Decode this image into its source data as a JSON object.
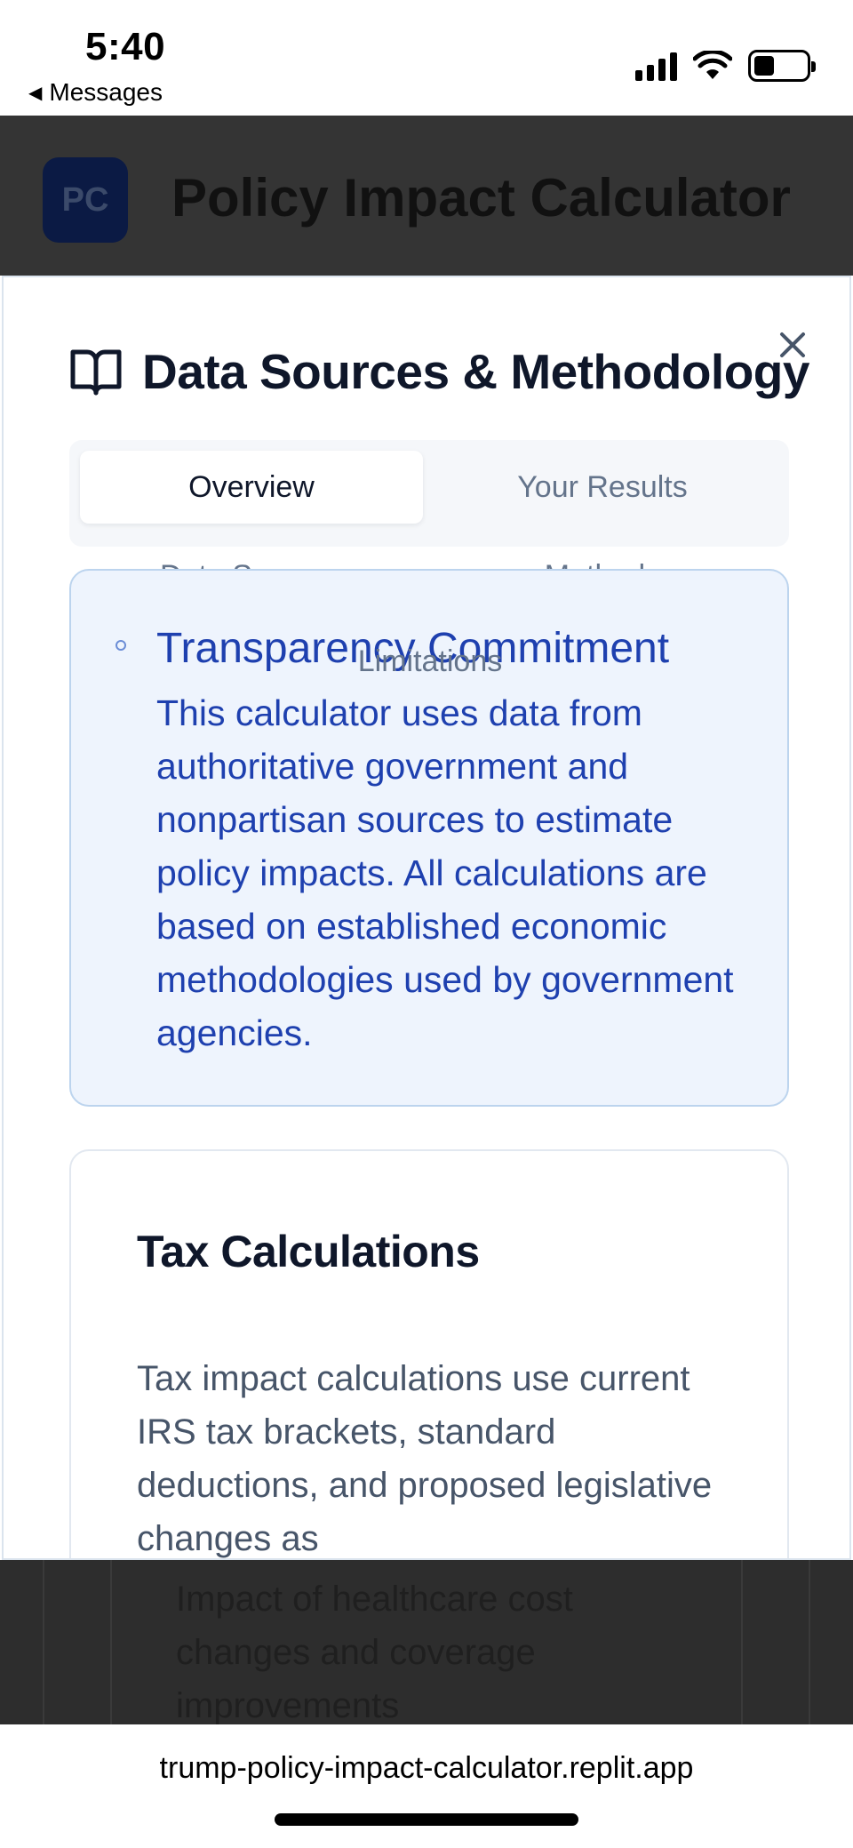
{
  "status_bar": {
    "time": "5:40",
    "back_label": "Messages",
    "back_icon": "back-triangle-icon"
  },
  "app_header": {
    "logo_text": "PC",
    "title": "Policy Impact Calculator"
  },
  "modal": {
    "title": "Data Sources & Methodology",
    "title_icon": "book-open-icon",
    "close_icon": "close-icon",
    "tabs": [
      {
        "label": "Overview",
        "active": true
      },
      {
        "label": "Your Results",
        "active": false
      },
      {
        "label": "Data Sources",
        "active": false
      },
      {
        "label": "Methods",
        "active": false
      },
      {
        "label": "Limitations",
        "active": false
      }
    ],
    "notice": {
      "title": "Transparency Commitment",
      "body": "This calculator uses data from authoritative government and nonpartisan sources to estimate policy impacts. All calculations are based on established economic methodologies used by government agencies."
    },
    "card": {
      "title": "Tax Calculations",
      "body": "Tax impact calculations use current IRS tax brackets, standard deductions, and proposed legislative changes as"
    }
  },
  "background_content": {
    "text": "Impact of healthcare cost changes and coverage improvements"
  },
  "browser": {
    "url": "trump-policy-impact-calculator.replit.app"
  },
  "colors": {
    "accent_blue": "#1e40af",
    "notice_bg": "#eef4fd",
    "overlay_dark": "#343434"
  }
}
